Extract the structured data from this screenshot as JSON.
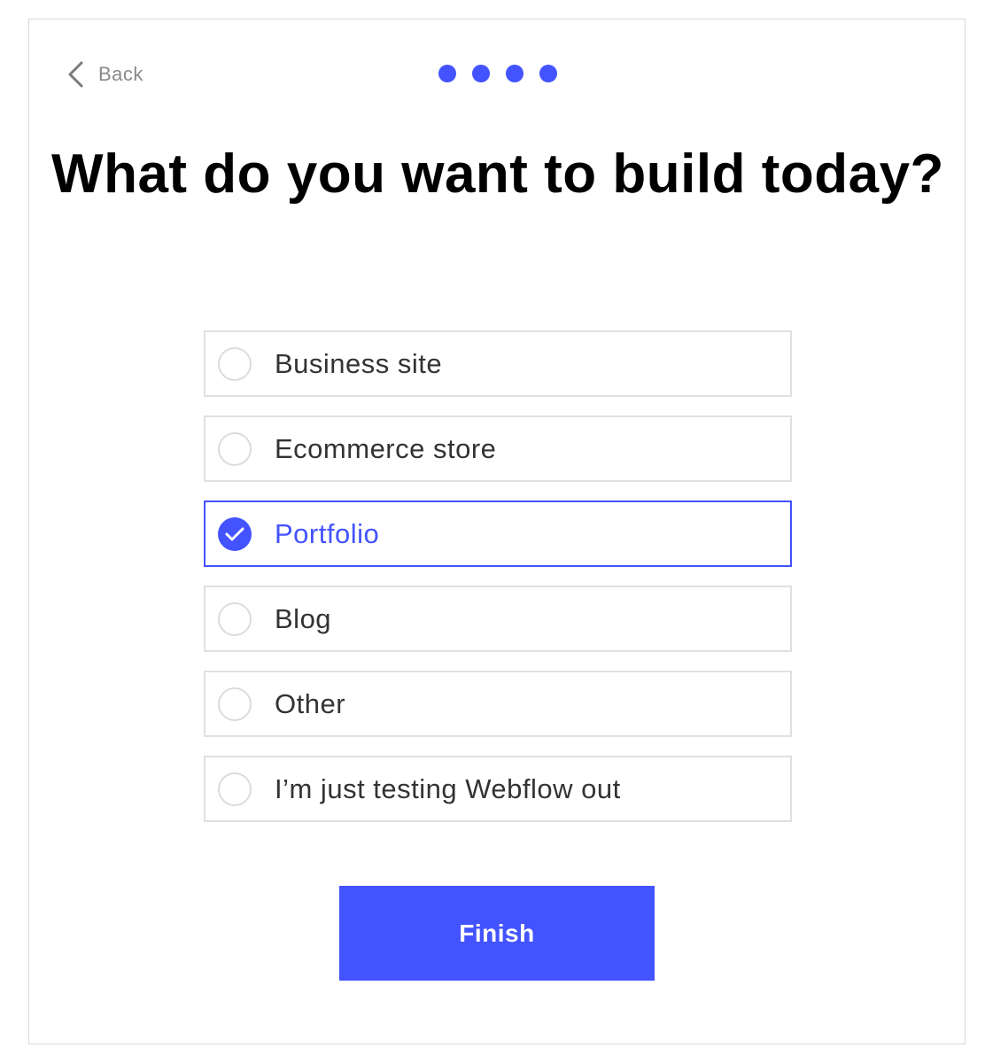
{
  "nav": {
    "back_label": "Back",
    "back_icon": "chevron-left-icon"
  },
  "progress": {
    "steps_total": 4,
    "steps_completed": 4
  },
  "question": {
    "title": "What do you want to build today?"
  },
  "options": [
    {
      "label": "Business site",
      "selected": false
    },
    {
      "label": "Ecommerce store",
      "selected": false
    },
    {
      "label": "Portfolio",
      "selected": true
    },
    {
      "label": "Blog",
      "selected": false
    },
    {
      "label": "Other",
      "selected": false
    },
    {
      "label": "I’m just testing Webflow out",
      "selected": false
    }
  ],
  "actions": {
    "finish_label": "Finish"
  },
  "colors": {
    "accent": "#4353ff",
    "text": "#333333",
    "muted": "#8a8a8a",
    "border": "#e0e0e0"
  }
}
